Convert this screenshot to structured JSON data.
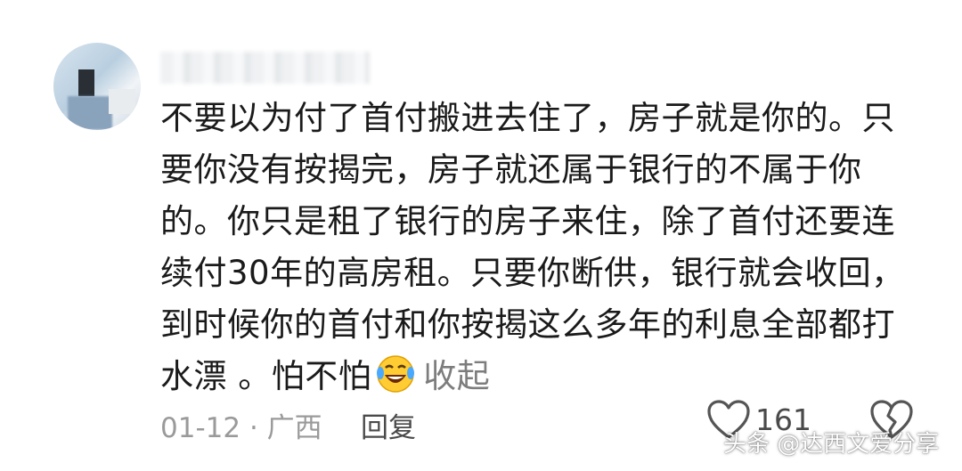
{
  "comment": {
    "lines": [
      "不要以为付了首付搬进去住了，房子就是你的。只",
      "要你没有按揭完，房子就还属于银行的不属于你",
      "的。你只是租了银行的房子来住，除了首付还要连",
      "续付30年的高房租。只要你断供，银行就会收回，",
      "到时候你的首付和你按揭这么多年的利息全部都打",
      "水漂 。怕不怕"
    ],
    "collapse_label": "收起",
    "emoji_icon": "laughing-crying-emoji"
  },
  "meta": {
    "date": "01-12",
    "separator": "·",
    "location": "广西",
    "reply_label": "回复"
  },
  "actions": {
    "like_count": "161",
    "like_icon": "heart-outline-icon",
    "dislike_icon": "broken-heart-outline-icon"
  },
  "watermark": "头条 @达西文爱分享"
}
